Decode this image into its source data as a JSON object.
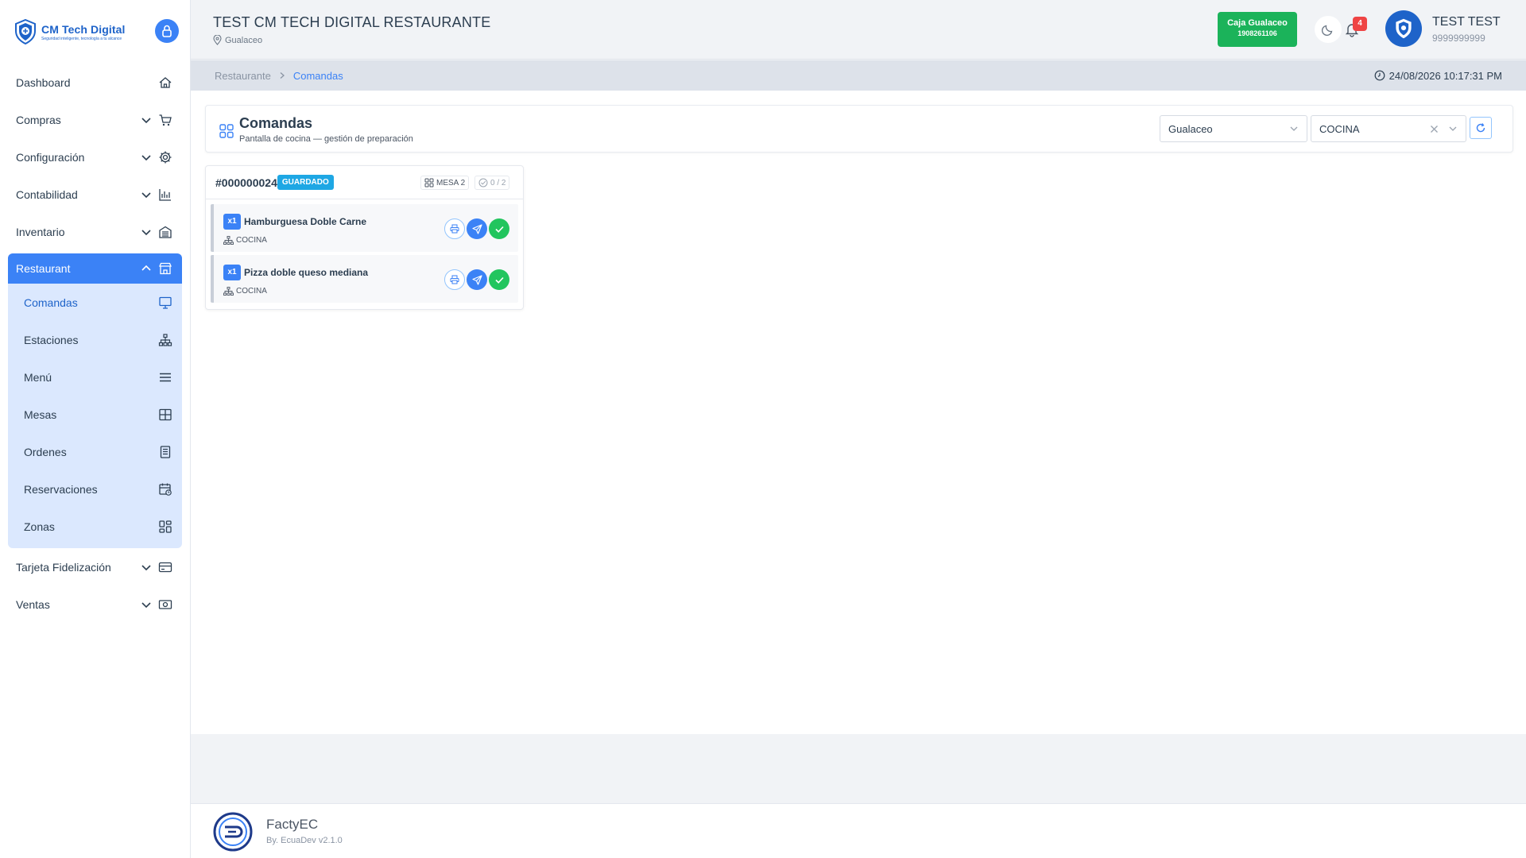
{
  "brand": {
    "title": "CM Tech Digital",
    "subtitle": "Seguridad inteligente, tecnología a tu alcance"
  },
  "sidebar": {
    "items": [
      {
        "label": "Dashboard",
        "icon": "home-icon"
      },
      {
        "label": "Compras",
        "icon": "cart-icon"
      },
      {
        "label": "Configuración",
        "icon": "gear-icon"
      },
      {
        "label": "Contabilidad",
        "icon": "bar-chart-icon"
      },
      {
        "label": "Inventario",
        "icon": "warehouse-icon"
      },
      {
        "label": "Restaurant",
        "icon": "store-icon"
      },
      {
        "label": "Tarjeta Fidelización",
        "icon": "card-icon"
      },
      {
        "label": "Ventas",
        "icon": "money-icon"
      }
    ],
    "restaurant_sub": [
      {
        "label": "Comandas",
        "icon": "monitor-icon"
      },
      {
        "label": "Estaciones",
        "icon": "hierarchy-icon"
      },
      {
        "label": "Menú",
        "icon": "menu-lines-icon"
      },
      {
        "label": "Mesas",
        "icon": "table-grid-icon"
      },
      {
        "label": "Ordenes",
        "icon": "receipt-icon"
      },
      {
        "label": "Reservaciones",
        "icon": "calendar-clock-icon"
      },
      {
        "label": "Zonas",
        "icon": "zones-grid-icon"
      }
    ]
  },
  "header": {
    "title": "TEST CM TECH DIGITAL RESTAURANTE",
    "location": "Gualaceo",
    "caja_title": "Caja Gualaceo",
    "caja_code": "1908261106",
    "notifications": "4",
    "user_name": "TEST TEST",
    "user_id": "9999999999"
  },
  "breadcrumb": {
    "parent": "Restaurante",
    "current": "Comandas",
    "datetime": "24/08/2026 10:17:31 PM"
  },
  "page": {
    "title": "Comandas",
    "subtitle": "Pantalla de cocina — gestión de preparación",
    "branch_select": "Gualaceo",
    "station_select": "COCINA"
  },
  "order": {
    "number": "#000000024",
    "status": "GUARDADO",
    "table": "MESA 2",
    "progress": "0 / 2",
    "items": [
      {
        "qty": "x1",
        "name": "Hamburguesa Doble Carne",
        "station": "COCINA"
      },
      {
        "qty": "x1",
        "name": "Pizza doble queso mediana",
        "station": "COCINA"
      }
    ]
  },
  "footer": {
    "name": "FactyEC",
    "version": "By. EcuaDev v2.1.0"
  },
  "colors": {
    "primary": "#3b82f6",
    "success": "#1bb35a",
    "danger": "#ef4444",
    "badge": "#1ea7e4"
  }
}
